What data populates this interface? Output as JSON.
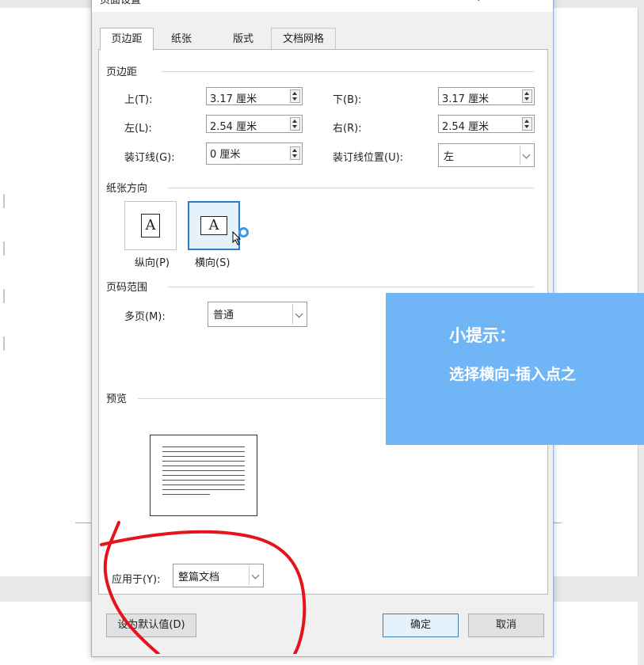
{
  "dialog": {
    "title": "页面设置",
    "help_glyph": "?",
    "close_glyph": "✕"
  },
  "tabs": [
    {
      "label": "页边距",
      "active": true
    },
    {
      "label": "纸张",
      "active": false
    },
    {
      "label": "版式",
      "active": false
    },
    {
      "label": "文档网格",
      "active": false
    }
  ],
  "margins": {
    "group_label": "页边距",
    "top": {
      "label": "上(T):",
      "key": "T",
      "value": "3.17 厘米"
    },
    "bottom": {
      "label": "下(B):",
      "key": "B",
      "value": "3.17 厘米"
    },
    "left": {
      "label": "左(L):",
      "key": "L",
      "value": "2.54 厘米"
    },
    "right": {
      "label": "右(R):",
      "key": "R",
      "value": "2.54 厘米"
    },
    "gutter": {
      "label": "装订线(G):",
      "key": "G",
      "value": "0 厘米"
    },
    "gutter_position": {
      "label": "装订线位置(U):",
      "key": "U",
      "value": "左"
    }
  },
  "orientation": {
    "group_label": "纸张方向",
    "portrait": {
      "label": "纵向(P)",
      "key": "P",
      "glyph": "A"
    },
    "landscape": {
      "label": "横向(S)",
      "key": "S",
      "glyph": "A",
      "selected": true
    }
  },
  "pages": {
    "group_label": "页码范围",
    "multiple": {
      "label": "多页(M):",
      "key": "M",
      "value": "普通"
    }
  },
  "preview": {
    "group_label": "预览"
  },
  "apply_to": {
    "label": "应用于(Y):",
    "key": "Y",
    "value": "整篇文档"
  },
  "buttons": {
    "set_default": "设为默认值(D)",
    "ok": "确定",
    "cancel": "取消"
  },
  "tip": {
    "title": "小提示：",
    "text": "选择横向-插入点之"
  },
  "colors": {
    "tip_bg": "#70b5f5",
    "selected_border": "#2b7ccf",
    "annotation_red": "#e5131b"
  }
}
